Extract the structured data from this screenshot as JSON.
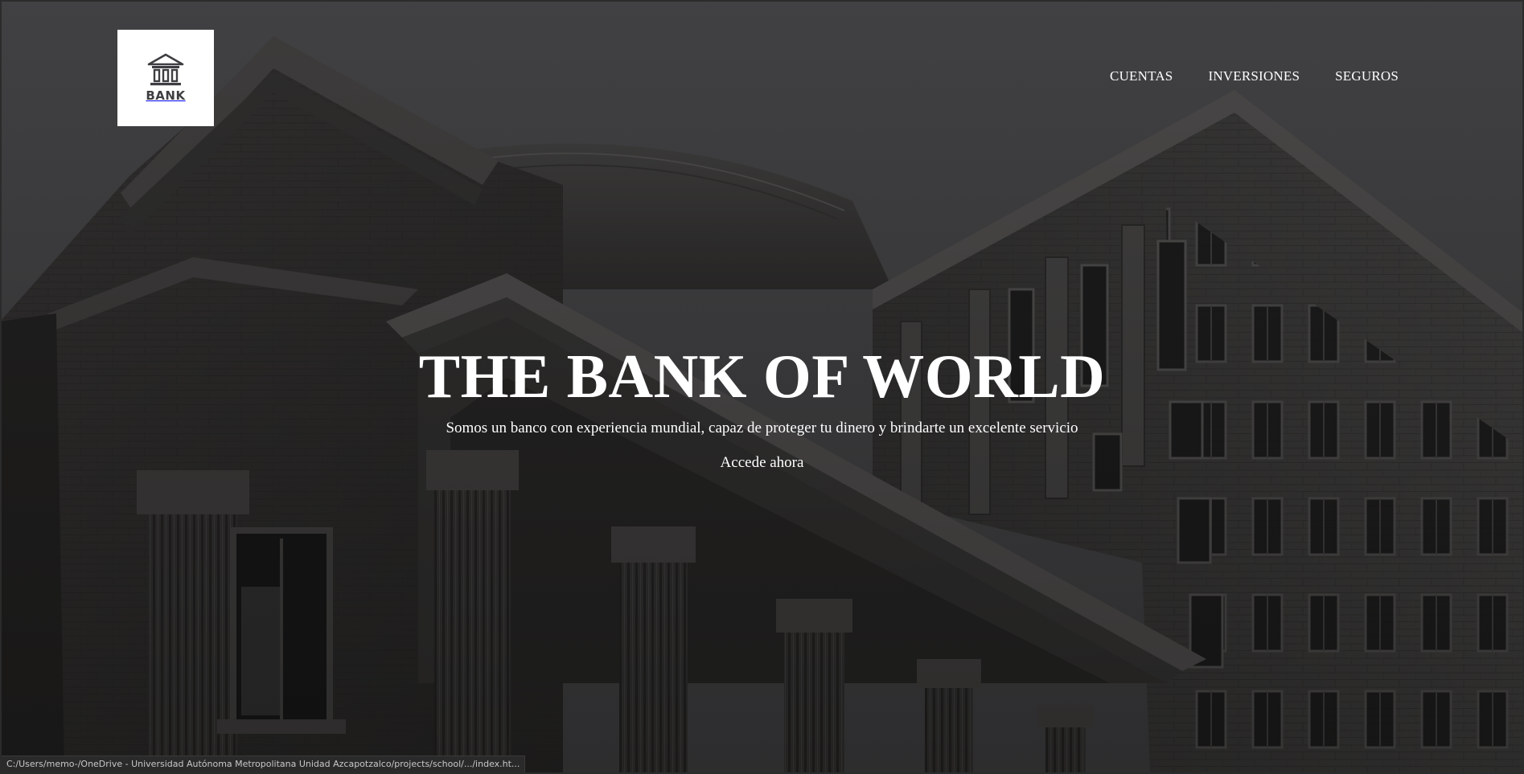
{
  "logo": {
    "label": "BANK",
    "icon": "bank-building-icon"
  },
  "nav": {
    "items": [
      {
        "label": "CUENTAS"
      },
      {
        "label": "INVERSIONES"
      },
      {
        "label": "SEGUROS"
      }
    ]
  },
  "hero": {
    "title": "THE BANK OF WORLD",
    "subtitle": "Somos un banco con experiencia mundial, capaz de proteger tu dinero y brindarte un excelente servicio",
    "cta_label": "Accede ahora"
  },
  "status_bar": {
    "url": "C:/Users/memo-/OneDrive - Universidad Autónoma Metropolitana Unidad Azcapotzalco/projects/school/.../index.ht..."
  },
  "colors": {
    "background": "#404042",
    "text": "#ffffff",
    "logo_bg": "#ffffff",
    "logo_fg": "#3e3e42"
  }
}
